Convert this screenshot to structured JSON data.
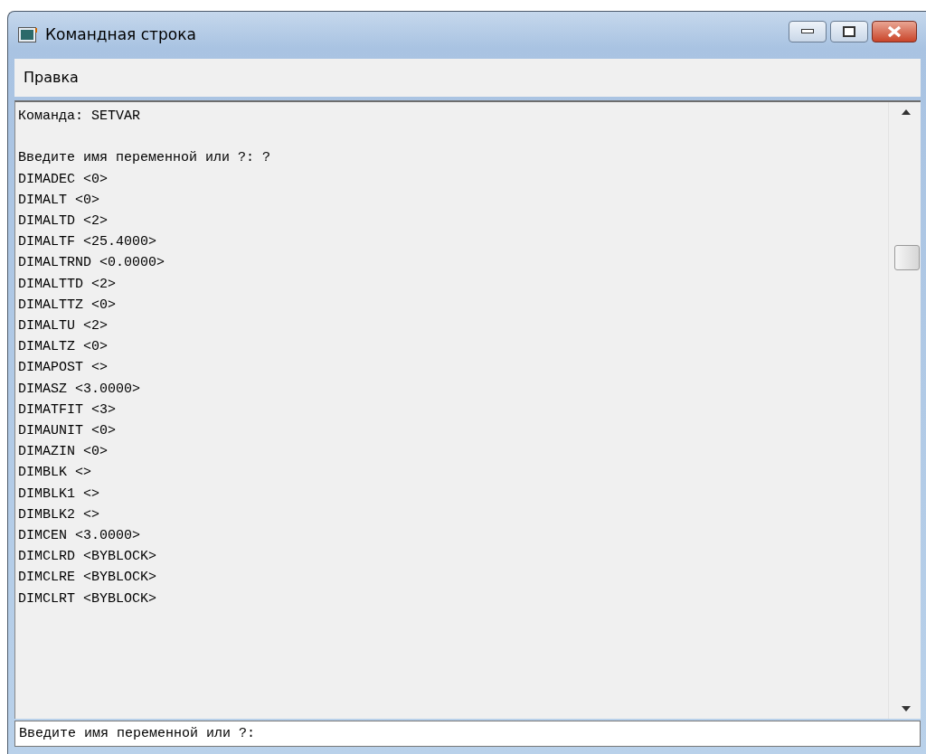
{
  "window": {
    "title": "Командная строка"
  },
  "menu": [
    {
      "label": "Правка"
    }
  ],
  "output": {
    "blocks": [
      [
        "Команда: SETVAR"
      ],
      [
        "Введите имя переменной или ?: ?",
        "DIMADEC <0>",
        "DIMALT <0>",
        "DIMALTD <2>",
        "DIMALTF <25.4000>",
        "DIMALTRND <0.0000>",
        "DIMALTTD <2>",
        "DIMALTTZ <0>",
        "DIMALTU <2>",
        "DIMALTZ <0>",
        "DIMAPOST <>",
        "DIMASZ <3.0000>",
        "DIMATFIT <3>",
        "DIMAUNIT <0>",
        "DIMAZIN <0>",
        "DIMBLK <>",
        "DIMBLK1 <>",
        "DIMBLK2 <>",
        "DIMCEN <3.0000>",
        "DIMCLRD <BYBLOCK>",
        "DIMCLRE <BYBLOCK>",
        "DIMCLRT <BYBLOCK>"
      ]
    ]
  },
  "prompt": {
    "value": "Введите имя переменной или ?:"
  }
}
